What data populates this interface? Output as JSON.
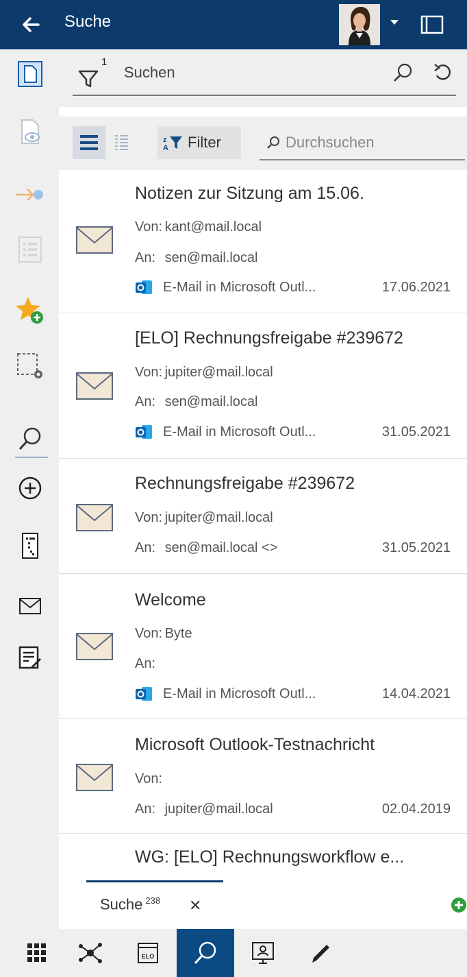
{
  "header": {
    "title": "Suche",
    "back_icon": "arrow-left-icon",
    "menu_icon": "chevron-down-icon",
    "panel_icon": "panel-icon"
  },
  "search": {
    "placeholder": "Suchen",
    "filter_count": "1"
  },
  "toolbar": {
    "filter_label": "Filter",
    "browse_placeholder": "Durchsuchen"
  },
  "results": [
    {
      "subject": "Notizen zur Sitzung am 15.06.",
      "from_label": "Von:",
      "from": "kant@mail.local",
      "to_label": "An:",
      "to": "sen@mail.local",
      "type": "E-Mail in Microsoft Outl...",
      "date": "17.06.2021"
    },
    {
      "subject": "[ELO] Rechnungsfreigabe #239672",
      "from_label": "Von:",
      "from": "jupiter@mail.local",
      "to_label": "An:",
      "to": "sen@mail.local",
      "type": "E-Mail in Microsoft Outl...",
      "date": "31.05.2021"
    },
    {
      "subject": "Rechnungsfreigabe #239672",
      "from_label": "Von:",
      "from": "jupiter@mail.local",
      "to_label": "An:",
      "to": "sen@mail.local <>",
      "type": "",
      "date": "31.05.2021"
    },
    {
      "subject": "Welcome",
      "from_label": "Von:",
      "from": "Byte",
      "to_label": "An:",
      "to": "",
      "type": "E-Mail in Microsoft Outl...",
      "date": "14.04.2021"
    },
    {
      "subject": "Microsoft Outlook-Testnachricht",
      "from_label": "Von:",
      "from": "",
      "to_label": "An:",
      "to": "jupiter@mail.local",
      "type": "",
      "date": "02.04.2019"
    },
    {
      "subject": "WG: [ELO]  Rechnungsworkflow e..."
    }
  ],
  "tabs": [
    {
      "label": "Suche",
      "count": "238"
    }
  ],
  "colors": {
    "header_bg": "#0b3a6b",
    "active_nav": "#0b4a82",
    "accent_green": "#2e9e3e",
    "star": "#f3a81d"
  }
}
